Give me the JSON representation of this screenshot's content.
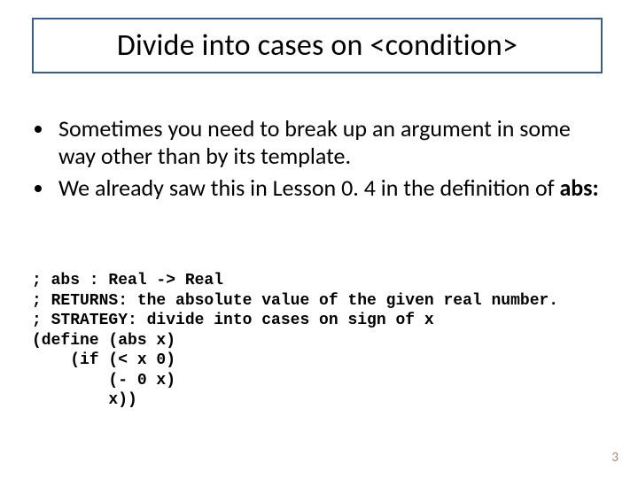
{
  "title": "Divide into cases on <condition>",
  "bullets": [
    {
      "pre": "Sometimes you need to break up an argument in some way other than by its template.",
      "bold": ""
    },
    {
      "pre": "We already saw this in Lesson 0. 4 in the definition of ",
      "bold": "abs:"
    }
  ],
  "code": "; abs : Real -> Real\n; RETURNS: the absolute value of the given real number.\n; STRATEGY: divide into cases on sign of x\n(define (abs x)\n    (if (< x 0)\n        (- 0 x)\n        x))",
  "page_number": "3"
}
